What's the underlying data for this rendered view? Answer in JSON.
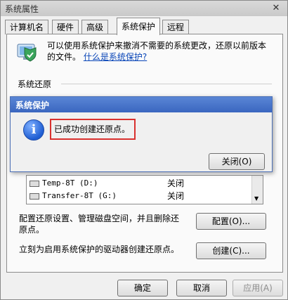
{
  "window": {
    "title": "系统属性",
    "close_glyph": "✕"
  },
  "tabs": [
    {
      "label": "计算机名"
    },
    {
      "label": "硬件"
    },
    {
      "label": "高级"
    },
    {
      "label": "系统保护"
    },
    {
      "label": "远程"
    }
  ],
  "protection": {
    "intro_text": "可以使用系统保护来撤消不需要的系统更改，还原以前版本的文件。",
    "intro_link": "什么是系统保护?",
    "restore_group_label": "系统还原"
  },
  "drives": [
    {
      "name": "Temp-8T (D:)",
      "status": "关闭"
    },
    {
      "name": "Transfer-8T (G:)",
      "status": "关闭"
    }
  ],
  "configure": {
    "text": "配置还原设置、管理磁盘空间，并且删除还原点。",
    "button_label": "配置(O)..."
  },
  "create": {
    "text": "立刻为启用系统保护的驱动器创建还原点。",
    "button_label": "创建(C)..."
  },
  "footer": {
    "ok_label": "确定",
    "cancel_label": "取消",
    "apply_label": "应用(A)"
  },
  "dialog": {
    "title": "系统保护",
    "message": "已成功创建还原点。",
    "close_label": "关闭(O)",
    "icon_glyph": "i"
  }
}
